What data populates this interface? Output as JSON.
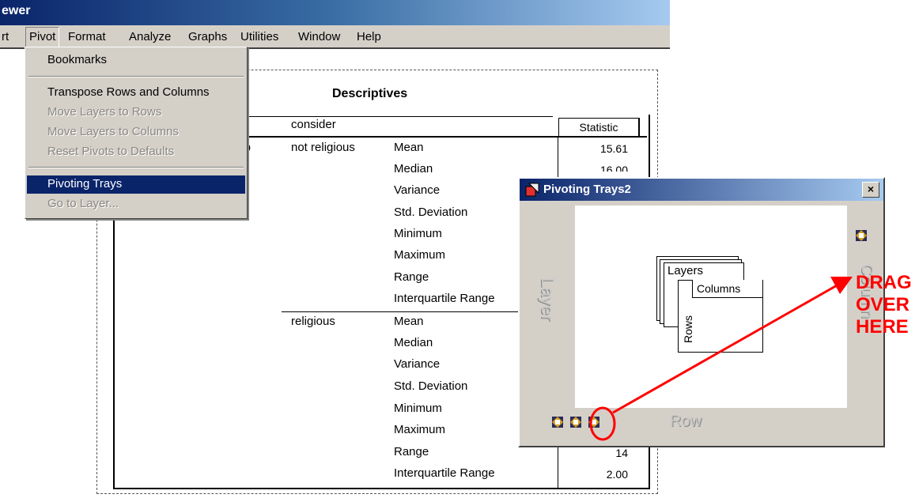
{
  "window": {
    "title": "ewer"
  },
  "menubar": {
    "items": [
      "rt",
      "Pivot",
      "Format",
      "Analyze",
      "Graphs",
      "Utilities",
      "Window",
      "Help"
    ]
  },
  "pivot_menu": {
    "items": [
      {
        "label": "Bookmarks",
        "enabled": true
      },
      {
        "label": "Transpose Rows and Columns",
        "enabled": true
      },
      {
        "label": "Move Layers to Rows",
        "enabled": false
      },
      {
        "label": "Move Layers to Columns",
        "enabled": false
      },
      {
        "label": "Reset Pivots to Defaults",
        "enabled": false
      },
      {
        "label": "Pivoting Trays",
        "enabled": true,
        "highlighted": true
      },
      {
        "label": "Go to Layer...",
        "enabled": false
      }
    ]
  },
  "table": {
    "title": "Descriptives",
    "header_col": "consider",
    "header_stat": "Statistic",
    "group_fragment": "hip",
    "groups": [
      {
        "name": "not religious",
        "rows": [
          {
            "stat": "Mean",
            "value": "15.61"
          },
          {
            "stat": "Median",
            "value": "16.00"
          },
          {
            "stat": "Variance",
            "value": ""
          },
          {
            "stat": "Std. Deviation",
            "value": ""
          },
          {
            "stat": "Minimum",
            "value": ""
          },
          {
            "stat": "Maximum",
            "value": ""
          },
          {
            "stat": "Range",
            "value": ""
          },
          {
            "stat": "Interquartile Range",
            "value": ""
          }
        ]
      },
      {
        "name": "religious",
        "rows": [
          {
            "stat": "Mean",
            "value": ""
          },
          {
            "stat": "Median",
            "value": ""
          },
          {
            "stat": "Variance",
            "value": ""
          },
          {
            "stat": "Std. Deviation",
            "value": ""
          },
          {
            "stat": "Minimum",
            "value": ""
          },
          {
            "stat": "Maximum",
            "value": ""
          },
          {
            "stat": "Range",
            "value": "14"
          },
          {
            "stat": "Interquartile Range",
            "value": "2.00"
          }
        ]
      }
    ]
  },
  "pivot_window": {
    "title": "Pivoting Trays2",
    "close_label": "×",
    "tray_layer": "Layer",
    "tray_column": "Column",
    "tray_row": "Row",
    "diagram": {
      "layers": "Layers",
      "columns": "Columns",
      "rows": "Rows"
    },
    "icon": "pivot-icon"
  },
  "annotation": {
    "lines": [
      "DRAG",
      "OVER",
      "HERE"
    ],
    "color": "#ff0000"
  }
}
